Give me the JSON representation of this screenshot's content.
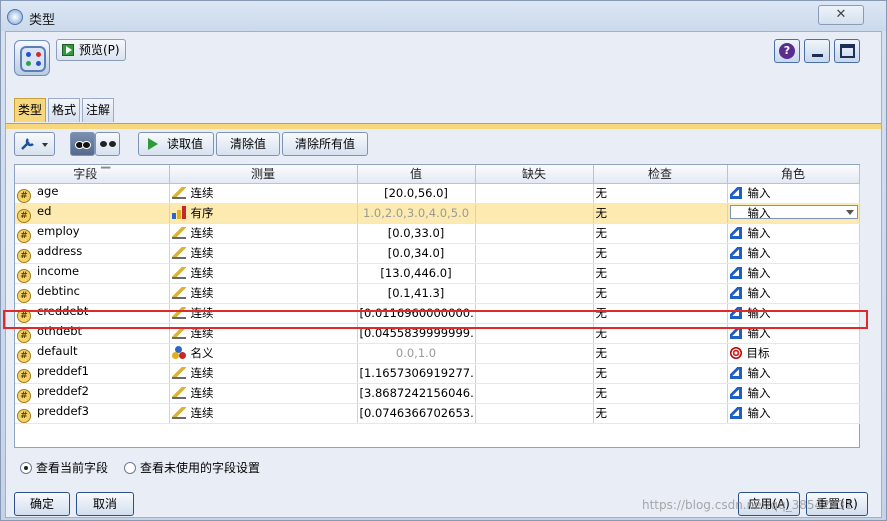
{
  "window": {
    "title": "类型",
    "close_glyph": "✕"
  },
  "toolbar": {
    "preview_label": "预览(P)",
    "help_glyph": "?"
  },
  "tabs": [
    {
      "label": "类型"
    },
    {
      "label": "格式"
    },
    {
      "label": "注解"
    }
  ],
  "actions": {
    "read_values": "读取值",
    "clear_values": "清除值",
    "clear_all_values": "清除所有值"
  },
  "grid": {
    "columns": {
      "field": "字段",
      "measure": "测量",
      "value": "值",
      "missing": "缺失",
      "check": "检查",
      "role": "角色"
    },
    "rows": [
      {
        "field": "age",
        "measure": "连续",
        "measure_icon": "continuous-icon",
        "value": "[20.0,56.0]",
        "missing": "",
        "check": "无",
        "role": "输入",
        "role_icon": "input-arrow-icon"
      },
      {
        "field": "ed",
        "measure": "有序",
        "measure_icon": "ordinal-icon",
        "value": "1.0,2.0,3.0,4.0,5.0",
        "missing": "",
        "check": "无",
        "role": "输入",
        "role_icon": "input-arrow-icon"
      },
      {
        "field": "employ",
        "measure": "连续",
        "measure_icon": "continuous-icon",
        "value": "[0.0,33.0]",
        "missing": "",
        "check": "无",
        "role": "输入",
        "role_icon": "input-arrow-icon"
      },
      {
        "field": "address",
        "measure": "连续",
        "measure_icon": "continuous-icon",
        "value": "[0.0,34.0]",
        "missing": "",
        "check": "无",
        "role": "输入",
        "role_icon": "input-arrow-icon"
      },
      {
        "field": "income",
        "measure": "连续",
        "measure_icon": "continuous-icon",
        "value": "[13.0,446.0]",
        "missing": "",
        "check": "无",
        "role": "输入",
        "role_icon": "input-arrow-icon"
      },
      {
        "field": "debtinc",
        "measure": "连续",
        "measure_icon": "continuous-icon",
        "value": "[0.1,41.3]",
        "missing": "",
        "check": "无",
        "role": "输入",
        "role_icon": "input-arrow-icon"
      },
      {
        "field": "creddebt",
        "measure": "连续",
        "measure_icon": "continuous-icon",
        "value": "[0.0116960000000...",
        "missing": "",
        "check": "无",
        "role": "输入",
        "role_icon": "input-arrow-icon"
      },
      {
        "field": "othdebt",
        "measure": "连续",
        "measure_icon": "continuous-icon",
        "value": "[0.0455839999999...",
        "missing": "",
        "check": "无",
        "role": "输入",
        "role_icon": "input-arrow-icon"
      },
      {
        "field": "default",
        "measure": "名义",
        "measure_icon": "nominal-icon",
        "value": "0.0,1.0",
        "missing": "",
        "check": "无",
        "role": "目标",
        "role_icon": "target-icon"
      },
      {
        "field": "preddef1",
        "measure": "连续",
        "measure_icon": "continuous-icon",
        "value": "[1.1657306919277...",
        "missing": "",
        "check": "无",
        "role": "输入",
        "role_icon": "input-arrow-icon"
      },
      {
        "field": "preddef2",
        "measure": "连续",
        "measure_icon": "continuous-icon",
        "value": "[3.8687242156046...",
        "missing": "",
        "check": "无",
        "role": "输入",
        "role_icon": "input-arrow-icon"
      },
      {
        "field": "preddef3",
        "measure": "连续",
        "measure_icon": "continuous-icon",
        "value": "[0.0746366702653...",
        "missing": "",
        "check": "无",
        "role": "输入",
        "role_icon": "input-arrow-icon"
      }
    ],
    "selected_row": 1,
    "highlighted_row": 8
  },
  "view_options": {
    "current_fields": "查看当前字段",
    "unused_fields": "查看未使用的字段设置",
    "selected": "current_fields"
  },
  "footer": {
    "ok": "确定",
    "cancel": "取消",
    "apply": "应用(A)",
    "reset": "重置(R)"
  },
  "watermark": "https://blog.csdn.net/qq_38542431",
  "colors": {
    "tab_active": "#f7d77e",
    "selected_row": "#fdeab0",
    "highlight_border": "#e02a2a"
  }
}
